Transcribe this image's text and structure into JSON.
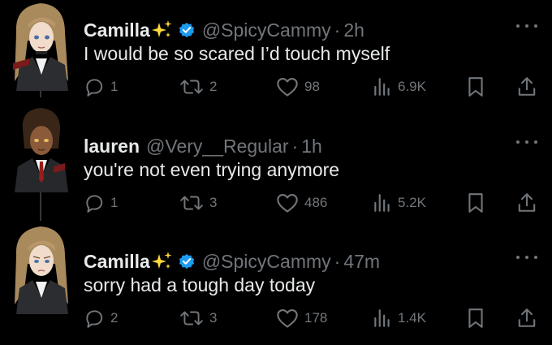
{
  "tweets": [
    {
      "name": "Camilla",
      "handle": "@SpicyCammy",
      "separator": "·",
      "time": "2h",
      "text": "I would be so scared I’d touch myself",
      "replies": "1",
      "reposts": "2",
      "likes": "98",
      "views": "6.9K",
      "verified": true,
      "emoji": "sparkles-icon"
    },
    {
      "name": "lauren",
      "handle": "@Very__Regular",
      "separator": "·",
      "time": "1h",
      "text": "you're not even trying anymore",
      "replies": "1",
      "reposts": "3",
      "likes": "486",
      "views": "5.2K",
      "verified": false,
      "emoji": ""
    },
    {
      "name": "Camilla",
      "handle": "@SpicyCammy",
      "separator": "·",
      "time": "47m",
      "text": "sorry had a tough day today",
      "replies": "2",
      "reposts": "3",
      "likes": "178",
      "views": "1.4K",
      "verified": true,
      "emoji": "sparkles-icon"
    }
  ],
  "colors": {
    "background": "#000000",
    "primary_text": "#e7e9ea",
    "secondary_text": "#71767b",
    "verified_blue": "#1d9bf0",
    "sparkle_yellow": "#ffd83d"
  }
}
